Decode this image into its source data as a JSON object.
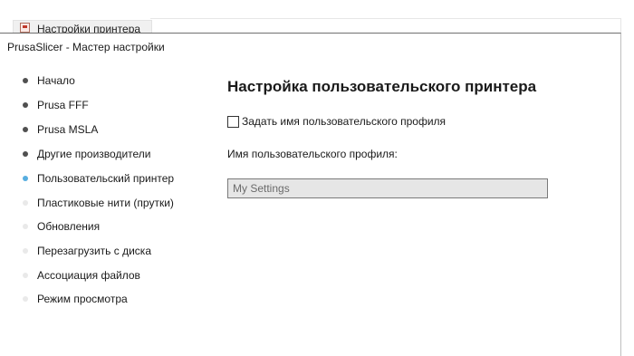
{
  "background_tab": {
    "label": "Настройки принтера",
    "icon": "printer-settings-icon"
  },
  "dialog": {
    "title": "PrusaSlicer - Мастер настройки"
  },
  "sidebar": {
    "items": [
      {
        "label": "Начало",
        "state": "done"
      },
      {
        "label": "Prusa FFF",
        "state": "done"
      },
      {
        "label": "Prusa MSLA",
        "state": "done"
      },
      {
        "label": "Другие производители",
        "state": "done"
      },
      {
        "label": "Пользовательский принтер",
        "state": "active"
      },
      {
        "label": "Пластиковые нити (прутки)",
        "state": "pending"
      },
      {
        "label": "Обновления",
        "state": "pending"
      },
      {
        "label": "Перезагрузить с диска",
        "state": "pending"
      },
      {
        "label": "Ассоциация файлов",
        "state": "pending"
      },
      {
        "label": "Режим просмотра",
        "state": "pending"
      }
    ],
    "colors": {
      "done": "#505050",
      "active": "#57aee0",
      "pending": "#e9e9e9"
    }
  },
  "main": {
    "title": "Настройка пользовательского принтера",
    "checkbox": {
      "label": "Задать имя пользовательского профиля",
      "checked": false
    },
    "profile_name_label": "Имя пользовательского профиля:",
    "profile_name_input": {
      "value": "My Settings",
      "disabled": true
    }
  }
}
